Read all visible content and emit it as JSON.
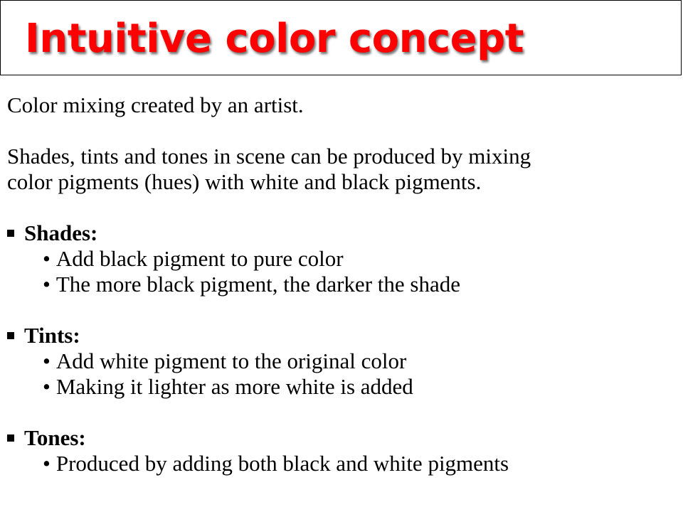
{
  "title": "Intuitive color concept",
  "intro": "Color mixing created by an artist.",
  "description": {
    "line1": "Shades, tints and tones in scene can be produced by mixing",
    "line2": "color pigments (hues) with white and black pigments."
  },
  "sections": [
    {
      "heading": "Shades:",
      "bullets": [
        "Add black pigment to pure color",
        "The more black pigment, the darker the shade"
      ]
    },
    {
      "heading": "Tints:",
      "bullets": [
        "Add white pigment to the original color",
        "Making it lighter as more white is added"
      ]
    },
    {
      "heading": "Tones:",
      "bullets": [
        "Produced by adding both black and white pigments"
      ]
    }
  ],
  "bullet_glyph": "•",
  "colors": {
    "title": "#ff0000",
    "text": "#000000",
    "background": "#ffffff"
  }
}
